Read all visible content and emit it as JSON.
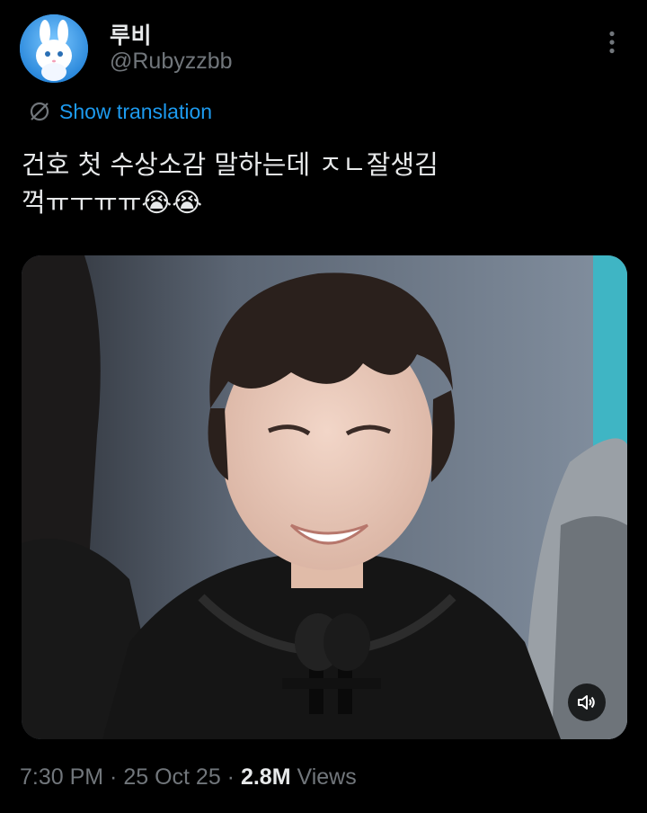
{
  "author": {
    "display_name": "루비",
    "handle": "@Rubyzzbb",
    "avatar_icon": "bunny-avatar-icon"
  },
  "menu": {
    "icon": "more-vertical-icon"
  },
  "translation": {
    "label": "Show translation",
    "icon": "translate-globe-icon"
  },
  "tweet": {
    "text": "건호 첫 수상소감 말하는데 ㅈㄴ잘생김\n꺽ㅠㅜㅠㅠ😭😭"
  },
  "media": {
    "type": "video",
    "mute_icon": "speaker-muted-icon"
  },
  "meta": {
    "time": "7:30 PM",
    "sep1": " · ",
    "date": "25 Oct 25",
    "sep2": " · ",
    "views_count": "2.8M",
    "views_label": " Views"
  },
  "colors": {
    "background": "#000000",
    "text_primary": "#e7e9ea",
    "text_secondary": "#71767b",
    "accent": "#1d9bf0"
  }
}
